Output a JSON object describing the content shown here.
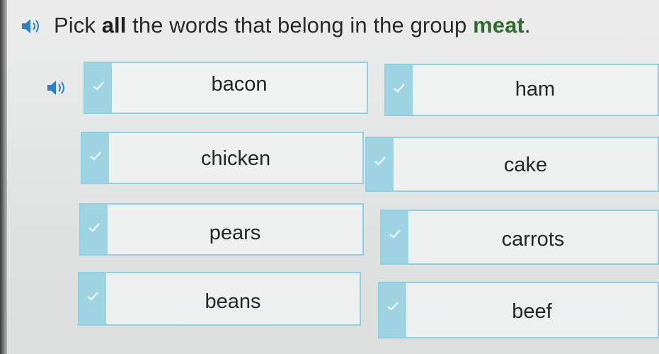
{
  "question": {
    "prefix": "Pick ",
    "emphasis": "all",
    "middle": " the words that belong in the group ",
    "group": "meat",
    "suffix": "."
  },
  "icons": {
    "speaker": "speaker-icon",
    "check": "checkmark-icon"
  },
  "colors": {
    "border": "#8fd1e4",
    "tab": "#9ed3e2",
    "text": "#262626"
  },
  "options": [
    {
      "label": "bacon"
    },
    {
      "label": "ham"
    },
    {
      "label": "chicken"
    },
    {
      "label": "cake"
    },
    {
      "label": "pears"
    },
    {
      "label": "carrots"
    },
    {
      "label": "beans"
    },
    {
      "label": "beef"
    }
  ]
}
